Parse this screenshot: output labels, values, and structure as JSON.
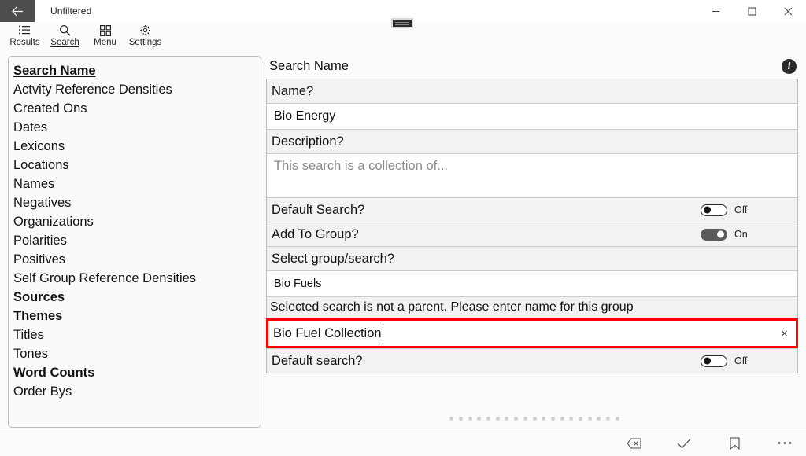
{
  "titlebar": {
    "back_label": "back-arrow",
    "title": "Unfiltered",
    "minimize": "−",
    "maximize": "☐",
    "close": "✕"
  },
  "commandbar": {
    "items": [
      {
        "label": "Results",
        "icon": "list-icon",
        "active": false
      },
      {
        "label": "Search",
        "icon": "search-icon",
        "active": true
      },
      {
        "label": "Menu",
        "icon": "grid-icon",
        "active": false
      },
      {
        "label": "Settings",
        "icon": "gear-icon",
        "active": false
      }
    ]
  },
  "sidebar": {
    "items": [
      {
        "label": "Search Name",
        "style": "selected"
      },
      {
        "label": "Actvity Reference Densities",
        "style": "normal"
      },
      {
        "label": "Created Ons",
        "style": "normal"
      },
      {
        "label": "Dates",
        "style": "normal"
      },
      {
        "label": "Lexicons",
        "style": "normal"
      },
      {
        "label": "Locations",
        "style": "normal"
      },
      {
        "label": "Names",
        "style": "normal"
      },
      {
        "label": "Negatives",
        "style": "normal"
      },
      {
        "label": "Organizations",
        "style": "normal"
      },
      {
        "label": "Polarities",
        "style": "normal"
      },
      {
        "label": "Positives",
        "style": "normal"
      },
      {
        "label": "Self Group Reference Densities",
        "style": "normal"
      },
      {
        "label": "Sources",
        "style": "bold"
      },
      {
        "label": "Themes",
        "style": "bold"
      },
      {
        "label": "Titles",
        "style": "normal"
      },
      {
        "label": "Tones",
        "style": "normal"
      },
      {
        "label": "Word Counts",
        "style": "bold"
      },
      {
        "label": "Order Bys",
        "style": "normal"
      }
    ]
  },
  "panel": {
    "title": "Search Name",
    "info_icon": "info-icon",
    "name_label": "Name?",
    "name_value": "Bio Energy",
    "description_label": "Description?",
    "description_placeholder": "This search is a collection of...",
    "default_search_label": "Default Search?",
    "default_search_state": "Off",
    "add_to_group_label": "Add To Group?",
    "add_to_group_state": "On",
    "select_group_label": "Select group/search?",
    "select_group_value": "Bio Fuels",
    "warning_text": "Selected search is not a parent.  Please enter name for this group",
    "group_name_value": "Bio Fuel Collection",
    "group_name_clear": "×",
    "default_search2_label": "Default search?",
    "default_search2_state": "Off",
    "highlight_color": "#ff0000"
  },
  "pagination": {
    "dot_count": 19
  },
  "bottombar": {
    "items": [
      {
        "name": "backspace-icon"
      },
      {
        "name": "check-icon"
      },
      {
        "name": "bookmark-icon"
      },
      {
        "name": "more-icon"
      }
    ]
  }
}
